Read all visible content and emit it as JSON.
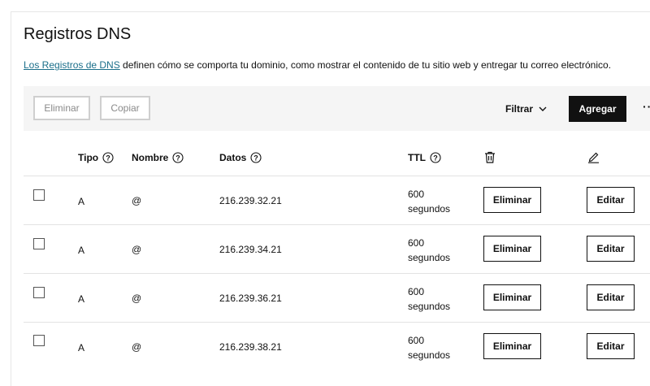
{
  "header": {
    "title": "Registros DNS",
    "desc_link": "Los Registros de DNS",
    "desc_text": " definen cómo se comporta tu dominio, como mostrar el contenido de tu sitio web y entregar tu correo electrónico."
  },
  "toolbar": {
    "delete_label": "Eliminar",
    "copy_label": "Copiar",
    "filter_label": "Filtrar",
    "add_label": "Agregar",
    "more_label": "···"
  },
  "table": {
    "columns": {
      "tipo": "Tipo",
      "nombre": "Nombre",
      "datos": "Datos",
      "ttl": "TTL"
    },
    "rows": [
      {
        "tipo": "A",
        "nombre": "@",
        "datos": "216.239.32.21",
        "ttl_value": "600",
        "ttl_unit": "segundos",
        "delete": "Eliminar",
        "edit": "Editar"
      },
      {
        "tipo": "A",
        "nombre": "@",
        "datos": "216.239.34.21",
        "ttl_value": "600",
        "ttl_unit": "segundos",
        "delete": "Eliminar",
        "edit": "Editar"
      },
      {
        "tipo": "A",
        "nombre": "@",
        "datos": "216.239.36.21",
        "ttl_value": "600",
        "ttl_unit": "segundos",
        "delete": "Eliminar",
        "edit": "Editar"
      },
      {
        "tipo": "A",
        "nombre": "@",
        "datos": "216.239.38.21",
        "ttl_value": "600",
        "ttl_unit": "segundos",
        "delete": "Eliminar",
        "edit": "Editar"
      }
    ]
  },
  "icons": {
    "help": "help-circle-icon",
    "trash": "trash-icon",
    "edit": "pencil-icon",
    "chevron": "chevron-down-icon"
  }
}
